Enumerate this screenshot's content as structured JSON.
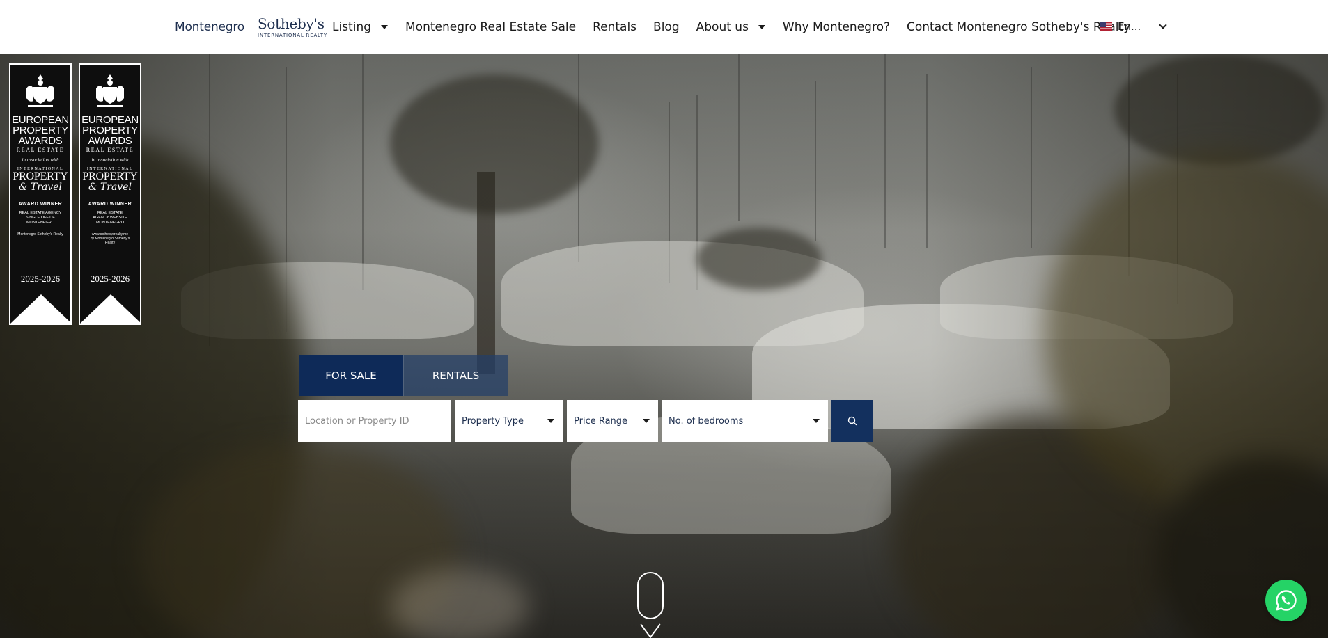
{
  "header": {
    "logo": {
      "left_text": "Montenegro",
      "brand": "Sotheby's",
      "sub": "INTERNATIONAL REALTY"
    },
    "nav": [
      {
        "label": "Listing",
        "has_dropdown": true
      },
      {
        "label": "Montenegro Real Estate Sale",
        "has_dropdown": false
      },
      {
        "label": "Rentals",
        "has_dropdown": false
      },
      {
        "label": "Blog",
        "has_dropdown": false
      },
      {
        "label": "About us",
        "has_dropdown": true
      },
      {
        "label": "Why Montenegro?",
        "has_dropdown": false
      },
      {
        "label": "Contact Montenegro Sotheby's Realty",
        "has_dropdown": false
      }
    ],
    "language": {
      "label": "En...",
      "flag": "us-flag-icon"
    }
  },
  "awards": [
    {
      "line1": "EUROPEAN",
      "line2": "PROPERTY",
      "line3": "AWARDS",
      "sub": "REAL ESTATE",
      "assoc": "in association with",
      "intl": "INTERNATIONAL",
      "prop": "PROPERTY",
      "travel": "& Travel",
      "winner": "AWARD WINNER",
      "category": "REAL ESTATE AGENCY\nSINGLE OFFICE\nMONTENEGRO",
      "by": "Montenegro Sotheby's Realty",
      "year": "2025-2026"
    },
    {
      "line1": "EUROPEAN",
      "line2": "PROPERTY",
      "line3": "AWARDS",
      "sub": "REAL ESTATE",
      "assoc": "in association with",
      "intl": "INTERNATIONAL",
      "prop": "PROPERTY",
      "travel": "& Travel",
      "winner": "AWARD WINNER",
      "category": "REAL ESTATE\nAGENCY WEBSITE\nMONTENEGRO",
      "by": "www.sothebysrealty.me\nby Montenegro Sotheby's\nRealty",
      "year": "2025-2026"
    }
  ],
  "search": {
    "tabs": [
      {
        "label": "FOR SALE",
        "active": true
      },
      {
        "label": "RENTALS",
        "active": false
      }
    ],
    "location_placeholder": "Location or Property ID",
    "property_type": "Property Type",
    "price_range": "Price Range",
    "bedrooms": "No. of bedrooms"
  },
  "colors": {
    "navy": "#0e2a58",
    "navy_button": "#13305e",
    "whatsapp": "#25d366",
    "text_dark": "#1b1b1b",
    "brand": "#1e2f4f"
  },
  "icons": {
    "search": "search-icon",
    "whatsapp": "whatsapp-icon",
    "scroll": "scroll-down-icon"
  }
}
